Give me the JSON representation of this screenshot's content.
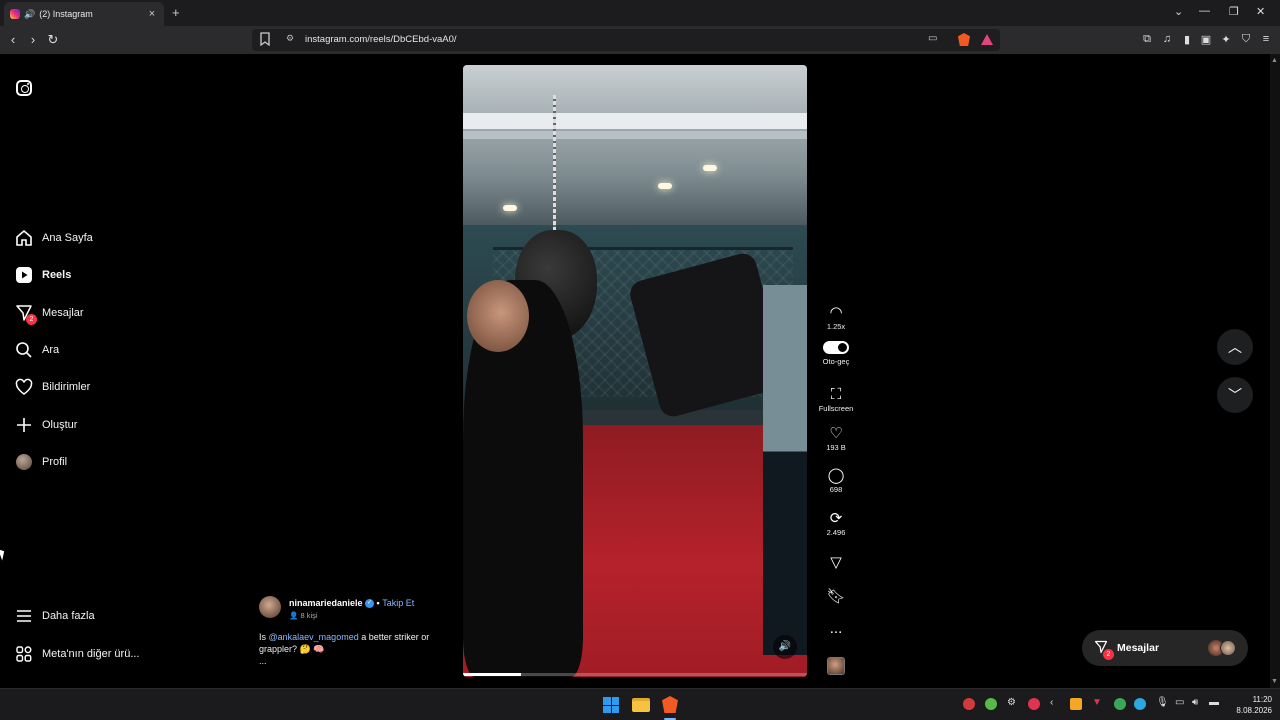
{
  "browser": {
    "tab_title": "(2) Instagram",
    "url": "instagram.com/reels/DbCEbd-vaA0/",
    "new_tab_glyph": "+",
    "colors": {
      "brave": "#f15a22",
      "accent": "#7cb6ff"
    }
  },
  "sidebar": {
    "items": [
      {
        "label": "Ana Sayfa",
        "icon": "home-icon"
      },
      {
        "label": "Reels",
        "icon": "reels-icon",
        "active": true
      },
      {
        "label": "Mesajlar",
        "icon": "messenger-icon",
        "badge": "2"
      },
      {
        "label": "Ara",
        "icon": "search-icon"
      },
      {
        "label": "Bildirimler",
        "icon": "heart-icon"
      },
      {
        "label": "Oluştur",
        "icon": "plus-icon"
      },
      {
        "label": "Profil",
        "icon": "avatar"
      }
    ],
    "more_label": "Daha fazla",
    "meta_label": "Meta'nın diğer ürü..."
  },
  "reel": {
    "username": "ninamariedaniele",
    "follow_label": "Takip Et",
    "people": "8 kişi",
    "caption_prefix": "Is ",
    "caption_mention": "@ankalaev_magomed",
    "caption_suffix": " a better striker or grappler? 🤔 🧠",
    "caption_more": "...",
    "progress": 0.17
  },
  "actions": {
    "speed": "1.25x",
    "autoplay": "Oto-geç",
    "fullscreen": "Fullscreen",
    "likes": "193 B",
    "comments": "698",
    "reposts": "2.496",
    "more": "..."
  },
  "messages_pill": {
    "label": "Mesajlar",
    "badge": "2"
  },
  "taskbar": {
    "time": "11:20",
    "date": "8.08.2026"
  },
  "colors": {
    "badge": "#ff3040",
    "link": "#8bb8ff",
    "floor": "#b5222b"
  }
}
